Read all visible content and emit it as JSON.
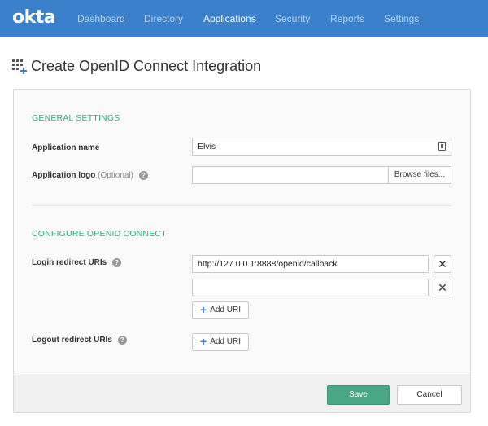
{
  "nav": {
    "logo": "okta",
    "items": [
      {
        "label": "Dashboard",
        "active": false
      },
      {
        "label": "Directory",
        "active": false
      },
      {
        "label": "Applications",
        "active": true
      },
      {
        "label": "Security",
        "active": false
      },
      {
        "label": "Reports",
        "active": false
      },
      {
        "label": "Settings",
        "active": false
      }
    ]
  },
  "page": {
    "title": "Create OpenID Connect Integration",
    "title_icon": "apps-add-icon"
  },
  "general": {
    "section_title": "GENERAL SETTINGS",
    "app_name_label": "Application name",
    "app_name_value": "Elvis",
    "app_logo_label": "Application logo",
    "app_logo_optional": "(Optional)",
    "browse_label": "Browse files...",
    "help_glyph": "?"
  },
  "oidc": {
    "section_title": "CONFIGURE OPENID CONNECT",
    "login_label": "Login redirect URIs",
    "login_uris": [
      "http://127.0.0.1:8888/openid/callback",
      ""
    ],
    "remove_glyph": "✕",
    "add_uri_label": "Add URI",
    "logout_label": "Logout redirect URIs"
  },
  "footer": {
    "save_label": "Save",
    "cancel_label": "Cancel"
  },
  "colors": {
    "nav_bg": "#3b80cb",
    "accent_green": "#2eaa82",
    "save_bg": "#4aa785"
  }
}
